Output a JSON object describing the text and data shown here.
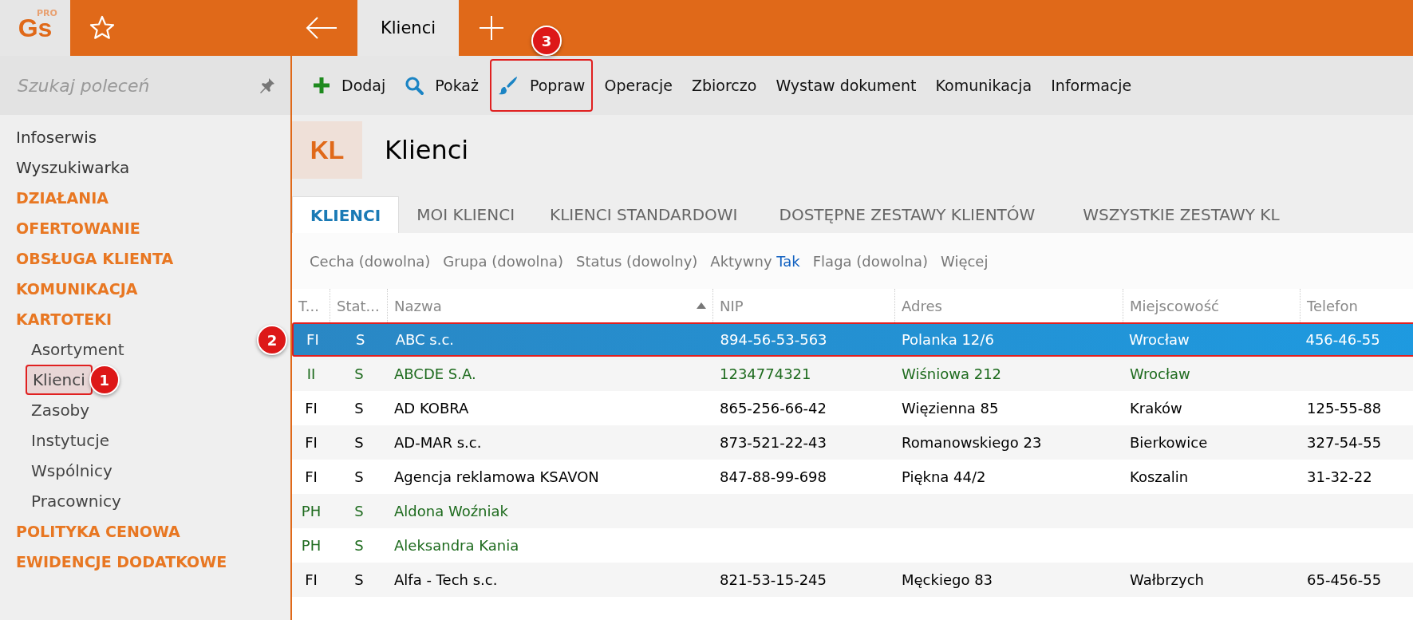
{
  "app_bar": {
    "logo": "Gs",
    "logo_badge": "PRO",
    "tabs": [
      {
        "label": "Klienci",
        "selected": true
      }
    ]
  },
  "sidebar": {
    "search": {
      "placeholder": "Szukaj poleceń"
    },
    "items": [
      {
        "label": "Infoserwis",
        "kind": "link"
      },
      {
        "label": "Wyszukiwarka",
        "kind": "link"
      },
      {
        "label": "DZIAŁANIA",
        "kind": "section"
      },
      {
        "label": "OFERTOWANIE",
        "kind": "section"
      },
      {
        "label": "OBSŁUGA KLIENTA",
        "kind": "section"
      },
      {
        "label": "KOMUNIKACJA",
        "kind": "section"
      },
      {
        "label": "KARTOTEKI",
        "kind": "section",
        "children": [
          {
            "label": "Asortyment",
            "selected": false
          },
          {
            "label": "Klienci",
            "selected": true,
            "callout": "1"
          },
          {
            "label": "Zasoby",
            "selected": false
          },
          {
            "label": "Instytucje",
            "selected": false
          },
          {
            "label": "Wspólnicy",
            "selected": false
          },
          {
            "label": "Pracownicy",
            "selected": false
          }
        ]
      },
      {
        "label": "POLITYKA CENOWA",
        "kind": "section"
      },
      {
        "label": "EWIDENCJE DODATKOWE",
        "kind": "section"
      }
    ]
  },
  "toolbar": [
    {
      "label": "Dodaj",
      "kind": "add"
    },
    {
      "label": "Pokaż",
      "kind": "search"
    },
    {
      "label": "Popraw",
      "kind": "edit",
      "callout": "3"
    },
    {
      "label": "Operacje",
      "kind": "text"
    },
    {
      "label": "Zbiorczo",
      "kind": "text"
    },
    {
      "label": "Wystaw dokument",
      "kind": "text"
    },
    {
      "label": "Komunikacja",
      "kind": "text"
    },
    {
      "label": "Informacje",
      "kind": "text"
    }
  ],
  "header": {
    "badge": "KL",
    "title": "Klienci"
  },
  "tabs": [
    {
      "label": "KLIENCI",
      "selected": true
    },
    {
      "label": "MOI KLIENCI",
      "selected": false
    },
    {
      "label": "KLIENCI STANDARDOWI",
      "selected": false
    },
    {
      "label": "DOSTĘPNE ZESTAWY KLIENTÓW",
      "selected": false
    },
    {
      "label": "WSZYSTKIE ZESTAWY KL",
      "selected": false
    }
  ],
  "filters": [
    {
      "label": "Cecha (dowolna)"
    },
    {
      "label": "Grupa (dowolna)"
    },
    {
      "label": "Status (dowolny)"
    },
    {
      "label": "Aktywny",
      "value": "Tak"
    },
    {
      "label": "Flaga (dowolna)"
    },
    {
      "label": "Więcej"
    }
  ],
  "table": {
    "columns": [
      {
        "label": "T..."
      },
      {
        "label": "Stat..."
      },
      {
        "label": "Nazwa",
        "sorted": true
      },
      {
        "label": "NIP"
      },
      {
        "label": "Adres"
      },
      {
        "label": "Miejscowość"
      },
      {
        "label": "Telefon"
      }
    ],
    "rows": [
      {
        "cells": [
          "FI",
          "S",
          "ABC s.c.",
          "894-56-53-563",
          "Polanka  12/6",
          "Wrocław",
          "456-46-55"
        ],
        "selected": true,
        "callout": "2"
      },
      {
        "cells": [
          "II",
          "S",
          "ABCDE S.A.",
          "1234774321",
          "Wiśniowa 212",
          "Wrocław",
          ""
        ],
        "selected": false,
        "color": "#1e6b1e"
      },
      {
        "cells": [
          "FI",
          "S",
          "AD KOBRA",
          "865-256-66-42",
          "Więzienna  85",
          "Kraków",
          "125-55-88"
        ],
        "selected": false,
        "color": "#000000"
      },
      {
        "cells": [
          "FI",
          "S",
          "AD-MAR s.c.",
          "873-521-22-43",
          "Romanowskiego 23",
          "Bierkowice",
          "327-54-55"
        ],
        "selected": false,
        "color": "#000000"
      },
      {
        "cells": [
          "FI",
          "S",
          "Agencja reklamowa KSAVON",
          "847-88-99-698",
          "Piękna  44/2",
          "Koszalin",
          "31-32-22"
        ],
        "selected": false,
        "color": "#000000"
      },
      {
        "cells": [
          "PH",
          "S",
          "Aldona Woźniak",
          "",
          "",
          "",
          ""
        ],
        "selected": false,
        "color": "#1e6b1e"
      },
      {
        "cells": [
          "PH",
          "S",
          "Aleksandra Kania",
          "",
          "",
          "",
          ""
        ],
        "selected": false,
        "color": "#1e6b1e"
      },
      {
        "cells": [
          "FI",
          "S",
          "Alfa - Tech s.c.",
          "821-53-15-245",
          "Męckiego  83",
          "Wałbrzych",
          "65-456-55"
        ],
        "selected": false,
        "color": "#000000"
      }
    ]
  }
}
